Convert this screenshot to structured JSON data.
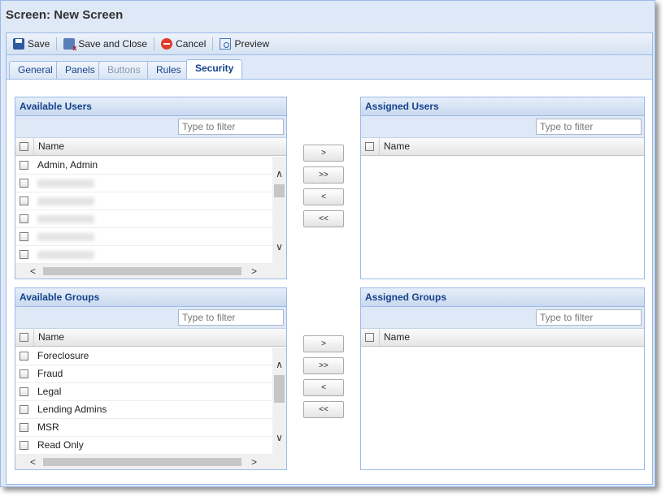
{
  "window": {
    "title": "Screen: New Screen"
  },
  "toolbar": {
    "save_label": "Save",
    "save_close_label": "Save and Close",
    "cancel_label": "Cancel",
    "preview_label": "Preview"
  },
  "tabs": [
    {
      "label": "General",
      "state": "normal"
    },
    {
      "label": "Panels",
      "state": "normal"
    },
    {
      "label": "Buttons",
      "state": "disabled"
    },
    {
      "label": "Rules",
      "state": "normal"
    },
    {
      "label": "Security",
      "state": "active"
    }
  ],
  "available_users": {
    "title": "Available Users",
    "filter_placeholder": "Type to filter",
    "column": "Name",
    "rows": [
      "Admin, Admin",
      "",
      "",
      "",
      "",
      ""
    ]
  },
  "assigned_users": {
    "title": "Assigned Users",
    "filter_placeholder": "Type to filter",
    "column": "Name"
  },
  "available_groups": {
    "title": "Available Groups",
    "filter_placeholder": "Type to filter",
    "column": "Name",
    "rows": [
      "Foreclosure",
      "Fraud",
      "Legal",
      "Lending Admins",
      "MSR",
      "Read Only"
    ]
  },
  "assigned_groups": {
    "title": "Assigned Groups",
    "filter_placeholder": "Type to filter",
    "column": "Name"
  },
  "move_buttons": {
    "add": ">",
    "add_all": ">>",
    "remove": "<",
    "remove_all": "<<"
  },
  "icons": {
    "save": "floppy-disk-icon",
    "save_close": "floppy-disk-close-icon",
    "cancel": "cancel-circle-icon",
    "preview": "magnifier-page-icon",
    "scroll_up": "∧",
    "scroll_down": "∨",
    "scroll_left": "<",
    "scroll_right": ">"
  }
}
